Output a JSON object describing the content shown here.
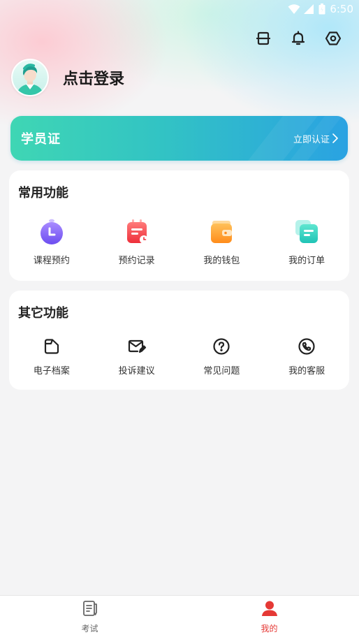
{
  "status_bar": {
    "time": "6:50"
  },
  "profile": {
    "login_text": "点击登录"
  },
  "student_card": {
    "title": "学员证",
    "action_label": "立即认证"
  },
  "common_functions": {
    "title": "常用功能",
    "items": [
      {
        "label": "课程预约",
        "icon": "clock-icon"
      },
      {
        "label": "预约记录",
        "icon": "calendar-record-icon"
      },
      {
        "label": "我的钱包",
        "icon": "wallet-icon"
      },
      {
        "label": "我的订单",
        "icon": "order-list-icon"
      }
    ]
  },
  "other_functions": {
    "title": "其它功能",
    "items": [
      {
        "label": "电子档案",
        "icon": "folder-icon"
      },
      {
        "label": "投诉建议",
        "icon": "mail-edit-icon"
      },
      {
        "label": "常见问题",
        "icon": "question-icon"
      },
      {
        "label": "我的客服",
        "icon": "phone-icon"
      }
    ]
  },
  "bottom_nav": {
    "items": [
      {
        "label": "考试",
        "icon": "exam-icon",
        "active": false
      },
      {
        "label": "我的",
        "icon": "user-icon",
        "active": true
      }
    ]
  },
  "colors": {
    "accent_red": "#e53935",
    "card_gradient_start": "#3fd6b4",
    "card_gradient_end": "#2aa2e2"
  }
}
